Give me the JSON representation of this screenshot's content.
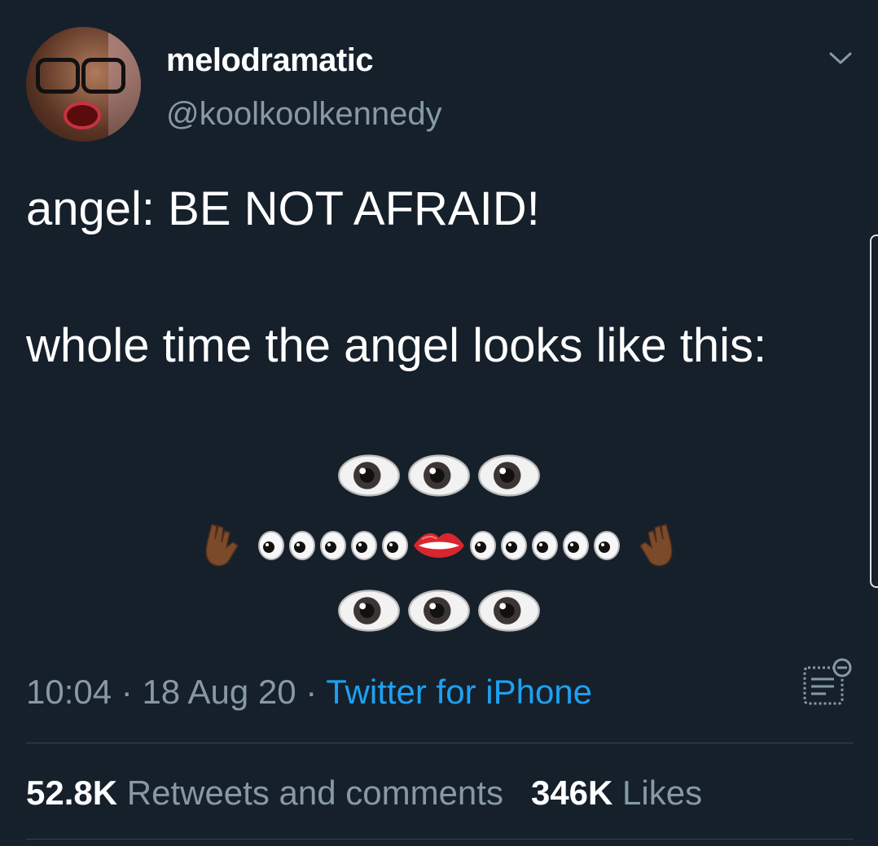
{
  "user": {
    "display_name": "melodramatic",
    "handle": "@koolkoolkennedy"
  },
  "tweet": {
    "line1": "angel: BE NOT AFRAID!",
    "line2": "whole time the angel looks like this:",
    "emoji_art": [
      [
        "eye",
        "eye",
        "eye"
      ],
      [
        "raised-hand",
        "small-eye",
        "small-eye",
        "small-eye",
        "small-eye",
        "small-eye",
        "lips",
        "small-eye",
        "small-eye",
        "small-eye",
        "small-eye",
        "small-eye",
        "raised-hand"
      ],
      [
        "eye",
        "eye",
        "eye"
      ]
    ]
  },
  "meta": {
    "time": "10:04",
    "separator1": " · ",
    "date": "18 Aug 20",
    "separator2": " · ",
    "source": "Twitter for iPhone"
  },
  "stats": {
    "retweets_count": "52.8K",
    "retweets_label": "Retweets and comments",
    "likes_count": "346K",
    "likes_label": "Likes"
  },
  "colors": {
    "background": "#15202b",
    "secondary_text": "#8899a6",
    "link": "#1da1f2",
    "divider": "#38444d"
  },
  "icons": [
    "chevron-down-icon",
    "tweet-analytics-icon"
  ]
}
